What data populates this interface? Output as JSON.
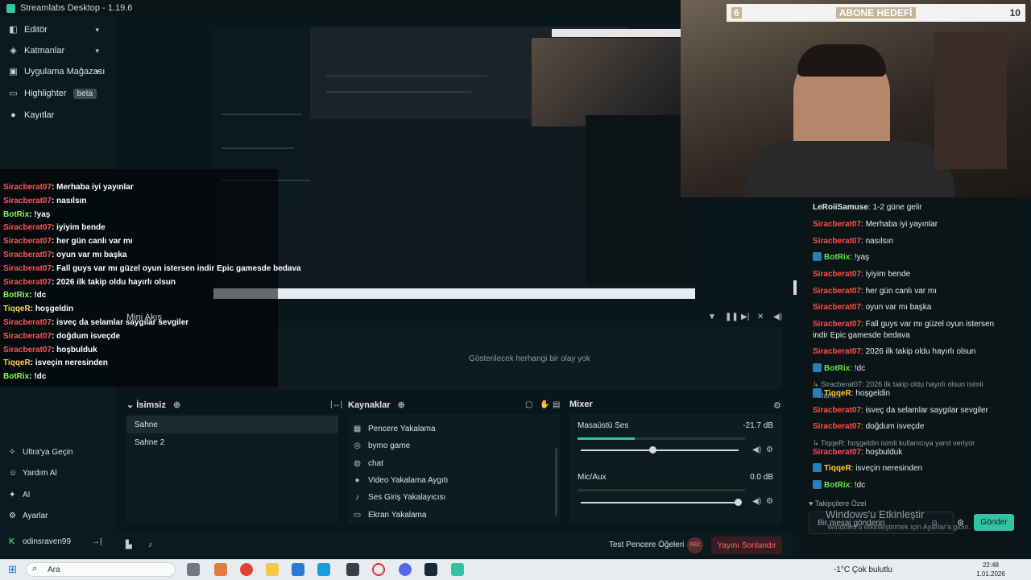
{
  "window": {
    "title": "Streamlabs Desktop - 1.19.6"
  },
  "nav": {
    "items": [
      {
        "label": "Editör",
        "icon": "editor-icon",
        "chevron": "⌄"
      },
      {
        "label": "Katmanlar",
        "icon": "layers-icon",
        "chevron": "⌄"
      },
      {
        "label": "Uygulama Mağazası",
        "icon": "store-icon",
        "chevron": "⌄"
      },
      {
        "label": "Highlighter",
        "icon": "highlighter-icon",
        "badge": "beta"
      },
      {
        "label": "Kayıtlar",
        "icon": "recordings-icon"
      }
    ],
    "bottom": [
      {
        "label": "Ultra'ya Geçin",
        "icon": "ultra-icon"
      },
      {
        "label": "Yardım Al",
        "icon": "help-icon"
      },
      {
        "label": "AI",
        "icon": "ai-icon"
      },
      {
        "label": "Ayarlar",
        "icon": "settings-icon"
      }
    ],
    "user": "odinsraven99"
  },
  "mini_feed": {
    "title": "Mini Akış",
    "empty": "Gösterilecek herhangi bir olay yok"
  },
  "scenes": {
    "title": "İsimsiz",
    "items": [
      "Sahne",
      "Sahne 2"
    ]
  },
  "sources": {
    "title": "Kaynaklar",
    "items": [
      {
        "label": "Pencere Yakalama",
        "icon": "window-capture-icon"
      },
      {
        "label": "bymo game",
        "icon": "game-capture-icon"
      },
      {
        "label": "chat",
        "icon": "browser-source-icon"
      },
      {
        "label": "Video Yakalama Aygıtı",
        "icon": "webcam-icon"
      },
      {
        "label": "Ses Giriş Yakalayıcısı",
        "icon": "mic-icon"
      },
      {
        "label": "Ekran Yakalama",
        "icon": "monitor-icon"
      }
    ]
  },
  "mixer": {
    "title": "Mixer",
    "channels": [
      {
        "name": "Masaüstü Ses",
        "db": "-21.7 dB",
        "level": 0.34,
        "volume": 0.46
      },
      {
        "name": "Mic/Aux",
        "db": "0.0 dB",
        "level": 0.0,
        "volume": 1.0
      }
    ]
  },
  "footer": {
    "test": "Test Pencere Öğeleri",
    "rec": "REC",
    "end": "Yayını Sonlandır"
  },
  "goal": {
    "start": "6",
    "label": "ABONE HEDEFİ",
    "end": "10"
  },
  "overlay_chat": [
    {
      "user": "Siracberat07",
      "text": ": Merhaba iyi yayınlar",
      "color": "#ff5555"
    },
    {
      "user": "Siracberat07",
      "text": ": nasılsın",
      "color": "#ff5555"
    },
    {
      "user": "BotRix",
      "text": ": !yaş",
      "color": "#7cff4f"
    },
    {
      "user": "Siracberat07",
      "text": ": iyiyim bende",
      "color": "#ff5555"
    },
    {
      "user": "Siracberat07",
      "text": ": her gün canlı var mı",
      "color": "#ff5555"
    },
    {
      "user": "Siracberat07",
      "text": ": oyun var mı başka",
      "color": "#ff5555"
    },
    {
      "user": "Siracberat07",
      "text": ": Fall guys var mı güzel oyun istersen indir Epic gamesde bedava",
      "color": "#ff5555"
    },
    {
      "user": "Siracberat07",
      "text": ": 2026 ilk takip oldu hayırlı olsun",
      "color": "#ff5555"
    },
    {
      "user": "BotRix",
      "text": ": !dc",
      "color": "#7cff4f"
    },
    {
      "user": "TiqqeR",
      "text": ": hoşgeldin",
      "color": "#ffd24a"
    },
    {
      "user": "Siracberat07",
      "text": ": isveç da selamlar saygılar sevgiler",
      "color": "#ff5555"
    },
    {
      "user": "Siracberat07",
      "text": ": doğdum isveçde",
      "color": "#ff5555"
    },
    {
      "user": "Siracberat07",
      "text": ": hoşbulduk",
      "color": "#ff5555"
    },
    {
      "user": "TiqqeR",
      "text": ": isveçin neresinden",
      "color": "#ffd24a"
    },
    {
      "user": "BotRix",
      "text": ": !dc",
      "color": "#7cff4f"
    }
  ],
  "chat": {
    "messages": [
      {
        "user": "LeRoiiSamuse",
        "text": ": 1-2 güne gelir",
        "color": "#e6ecef",
        "type": "msg"
      },
      {
        "user": "Siracberat07",
        "text": ": Merhaba iyi yayınlar",
        "color": "#ff4d4d",
        "type": "msg"
      },
      {
        "user": "Siracberat07",
        "text": ": nasılsın",
        "color": "#ff4d4d",
        "type": "msg"
      },
      {
        "user": "BotRix",
        "text": ": !yaş",
        "color": "#63e84a",
        "type": "msg"
      },
      {
        "user": "Siracberat07",
        "text": ": iyiyim bende",
        "color": "#ff4d4d",
        "type": "msg"
      },
      {
        "user": "Siracberat07",
        "text": ": her gün canlı var mı",
        "color": "#ff4d4d",
        "type": "msg"
      },
      {
        "user": "Siracberat07",
        "text": ": oyun var mı başka",
        "color": "#ff4d4d",
        "type": "msg"
      },
      {
        "user": "Siracberat07",
        "text": ": Fall guys var mı güzel oyun istersen indir Epic gamesde bedava",
        "color": "#ff4d4d",
        "type": "msg"
      },
      {
        "user": "Siracberat07",
        "text": ": 2026 ilk takip oldu hayırlı olsun",
        "color": "#ff4d4d",
        "type": "msg"
      },
      {
        "user": "BotRix",
        "text": ": !dc",
        "color": "#63e84a",
        "type": "msg"
      },
      {
        "user": "",
        "text": "↳ Siracberat07: 2026 ilk takip oldu hayırlı olsun isimli kullanı...",
        "color": "#8f9ba0",
        "type": "reply"
      },
      {
        "user": "TiqqeR",
        "text": ": hoşgeldin",
        "color": "#ffcc33",
        "type": "msg"
      },
      {
        "user": "Siracberat07",
        "text": ": isveç da selamlar saygılar sevgiler",
        "color": "#ff4d4d",
        "type": "msg"
      },
      {
        "user": "Siracberat07",
        "text": ": doğdum isveçde",
        "color": "#ff4d4d",
        "type": "msg"
      },
      {
        "user": "",
        "text": "↳ TiqqeR: hoşgeldin isimli kullanıcıya yanıt veriyor",
        "color": "#8f9ba0",
        "type": "reply"
      },
      {
        "user": "Siracberat07",
        "text": ": hoşbulduk",
        "color": "#ff4d4d",
        "type": "msg"
      },
      {
        "user": "TiqqeR",
        "text": ": isveçin neresinden",
        "color": "#ffcc33",
        "type": "msg"
      },
      {
        "user": "BotRix",
        "text": ": !dc",
        "color": "#63e84a",
        "type": "msg"
      }
    ],
    "followers": "Takipçilere Özel",
    "placeholder": "Bir mesaj gönderin",
    "send": "Gönder"
  },
  "watermark": {
    "line1": "Windows'u Etkinleştir",
    "line2": "Windows'u etkinleştirmek için Ayarlar'a gidin."
  },
  "taskbar": {
    "search": "Ara",
    "weather": "-1°C  Çok bulutlu",
    "time": "22:48",
    "date": "1.01.2026"
  }
}
